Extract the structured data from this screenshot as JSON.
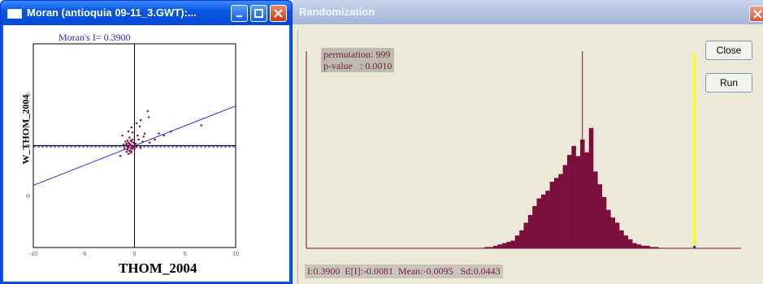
{
  "moran_window": {
    "title": "Moran (antioquia 09-11_3.GWT):...",
    "plot_title": "Moran's I= 0.3900",
    "x_label": "THOM_2004",
    "y_label": "W_THOM_2004",
    "x_ticks": [
      "-10",
      "-5",
      "0",
      "5",
      "10"
    ],
    "y_ticks": [
      "5",
      "0",
      "-5"
    ]
  },
  "randomization_window": {
    "title": "Randomization",
    "info_line1": "permutation: 999",
    "info_line2": "p-value   : 0.0010",
    "status": "I:0.3900  E[I]:-0.0081  Mean:-0.0095   Sd:0.0443",
    "buttons": {
      "close": "Close",
      "run": "Run"
    }
  },
  "colors": {
    "histogram": "#7a0f3d",
    "observed_marker": "#ffff00",
    "regression": "#2a2ae0",
    "points": "#7a0f3d"
  },
  "chart_data": [
    {
      "type": "scatter",
      "title": "Moran's I= 0.3900",
      "xlabel": "THOM_2004",
      "ylabel": "W_THOM_2004",
      "xlim": [
        -10,
        10
      ],
      "ylim": [
        -10,
        10
      ],
      "slope": 0.39,
      "points": [
        [
          -0.6,
          -0.2
        ],
        [
          -0.4,
          0.1
        ],
        [
          -0.2,
          -0.3
        ],
        [
          -0.8,
          0.2
        ],
        [
          -0.5,
          -0.5
        ],
        [
          -0.3,
          0.4
        ],
        [
          -0.1,
          -0.1
        ],
        [
          -0.7,
          -0.4
        ],
        [
          -0.9,
          0.0
        ],
        [
          -0.6,
          0.3
        ],
        [
          -0.2,
          0.6
        ],
        [
          -1.0,
          -0.3
        ],
        [
          -0.4,
          -0.7
        ],
        [
          0.1,
          0.2
        ],
        [
          -0.5,
          0.8
        ],
        [
          -0.8,
          -0.6
        ],
        [
          -0.3,
          -0.2
        ],
        [
          -0.6,
          0.0
        ],
        [
          -0.1,
          0.3
        ],
        [
          -0.7,
          0.5
        ],
        [
          -0.4,
          -0.4
        ],
        [
          -0.9,
          0.4
        ],
        [
          0.0,
          -0.3
        ],
        [
          -0.2,
          0.0
        ],
        [
          -0.5,
          0.2
        ],
        [
          -0.3,
          -0.6
        ],
        [
          -0.8,
          0.1
        ],
        [
          -0.6,
          -0.8
        ],
        [
          -0.4,
          0.5
        ],
        [
          0.2,
          -0.1
        ],
        [
          -1.1,
          0.1
        ],
        [
          -0.7,
          -0.1
        ],
        [
          0.4,
          0.6
        ],
        [
          0.8,
          0.4
        ],
        [
          1.5,
          0.3
        ],
        [
          0.6,
          -0.2
        ],
        [
          -0.3,
          1.8
        ],
        [
          -0.6,
          1.4
        ],
        [
          0.2,
          2.2
        ],
        [
          0.5,
          1.9
        ],
        [
          1.0,
          1.2
        ],
        [
          -1.2,
          1.0
        ],
        [
          0.3,
          1.0
        ],
        [
          1.4,
          2.8
        ],
        [
          0.6,
          2.5
        ],
        [
          1.3,
          3.4
        ],
        [
          2.4,
          1.2
        ],
        [
          2.9,
          1.0
        ],
        [
          3.6,
          1.4
        ],
        [
          6.6,
          2.0
        ],
        [
          2.0,
          0.6
        ],
        [
          -1.4,
          -1.0
        ],
        [
          -0.2,
          1.3
        ],
        [
          0.9,
          0.9
        ]
      ]
    },
    {
      "type": "bar",
      "title": "",
      "values": [
        1,
        1,
        2,
        3,
        4,
        5,
        6,
        10,
        14,
        20,
        26,
        33,
        39,
        42,
        45,
        52,
        55,
        58,
        65,
        73,
        80,
        72,
        85,
        75,
        94,
        60,
        50,
        40,
        30,
        24,
        20,
        14,
        10,
        7,
        4,
        3,
        2,
        2,
        1,
        1
      ],
      "peak_line_index": 22,
      "observed_index": 89,
      "n_bins": 100
    }
  ]
}
